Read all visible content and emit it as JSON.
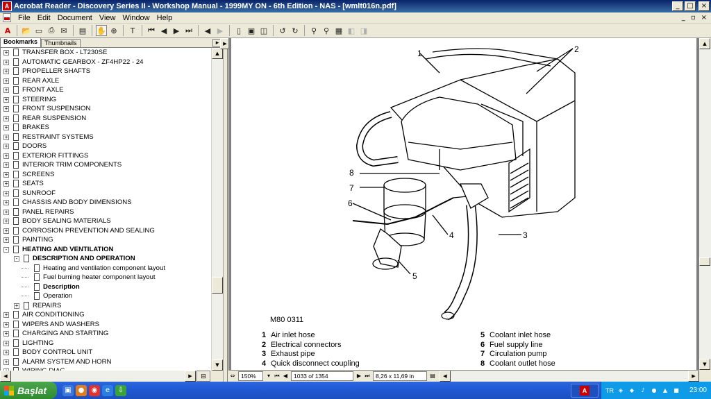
{
  "window": {
    "title": "Acrobat Reader - Discovery Series II - Workshop Manual - 1999MY ON - 6th Edition - NAS - [wmlt016n.pdf]",
    "buttons": [
      "_",
      "□",
      "×"
    ]
  },
  "menu": {
    "items": [
      "File",
      "Edit",
      "Document",
      "View",
      "Window",
      "Help"
    ],
    "doc_controls": [
      "_",
      "▫",
      "×"
    ]
  },
  "toolbar": {
    "icons": [
      "acrobat-icon",
      "open-icon",
      "save-icon",
      "print-icon",
      "email-icon",
      "show-hide-nav-icon",
      "hand-tool-icon",
      "zoom-tool-icon",
      "text-select-icon",
      "first-page-icon",
      "previous-page-icon",
      "next-page-icon",
      "last-page-icon",
      "go-back-icon",
      "go-forward-icon",
      "actual-size-icon",
      "fit-page-icon",
      "fit-width-icon",
      "rotate-left-icon",
      "rotate-right-icon",
      "find-icon",
      "search-icon",
      "search-results-icon",
      "previous-highlight-icon",
      "next-highlight-icon"
    ]
  },
  "nav": {
    "tabs": [
      "Bookmarks",
      "Thumbnails"
    ],
    "tab_menu": "▸",
    "bookmarks": [
      {
        "label": "TRANSFER BOX - LT230SE",
        "level": 0,
        "expand": "+",
        "bold": false
      },
      {
        "label": "AUTOMATIC GEARBOX - ZF4HP22 - 24",
        "level": 0,
        "expand": "+",
        "bold": false
      },
      {
        "label": "PROPELLER SHAFTS",
        "level": 0,
        "expand": "+",
        "bold": false
      },
      {
        "label": "REAR AXLE",
        "level": 0,
        "expand": "+",
        "bold": false
      },
      {
        "label": "FRONT AXLE",
        "level": 0,
        "expand": "+",
        "bold": false
      },
      {
        "label": "STEERING",
        "level": 0,
        "expand": "+",
        "bold": false
      },
      {
        "label": "FRONT SUSPENSION",
        "level": 0,
        "expand": "+",
        "bold": false
      },
      {
        "label": "REAR SUSPENSION",
        "level": 0,
        "expand": "+",
        "bold": false
      },
      {
        "label": "BRAKES",
        "level": 0,
        "expand": "+",
        "bold": false
      },
      {
        "label": "RESTRAINT SYSTEMS",
        "level": 0,
        "expand": "+",
        "bold": false
      },
      {
        "label": "DOORS",
        "level": 0,
        "expand": "+",
        "bold": false
      },
      {
        "label": "EXTERIOR FITTINGS",
        "level": 0,
        "expand": "+",
        "bold": false
      },
      {
        "label": "INTERIOR TRIM COMPONENTS",
        "level": 0,
        "expand": "+",
        "bold": false
      },
      {
        "label": "SCREENS",
        "level": 0,
        "expand": "+",
        "bold": false
      },
      {
        "label": "SEATS",
        "level": 0,
        "expand": "+",
        "bold": false
      },
      {
        "label": "SUNROOF",
        "level": 0,
        "expand": "+",
        "bold": false
      },
      {
        "label": "CHASSIS AND BODY DIMENSIONS",
        "level": 0,
        "expand": "+",
        "bold": false
      },
      {
        "label": "PANEL REPAIRS",
        "level": 0,
        "expand": "+",
        "bold": false
      },
      {
        "label": "BODY SEALING MATERIALS",
        "level": 0,
        "expand": "+",
        "bold": false
      },
      {
        "label": "CORROSION PREVENTION AND SEALING",
        "level": 0,
        "expand": "+",
        "bold": false
      },
      {
        "label": "PAINTING",
        "level": 0,
        "expand": "+",
        "bold": false
      },
      {
        "label": "HEATING AND VENTILATION",
        "level": 0,
        "expand": "-",
        "bold": true
      },
      {
        "label": "DESCRIPTION AND OPERATION",
        "level": 1,
        "expand": "-",
        "bold": true
      },
      {
        "label": "Heating and ventilation component layout",
        "level": 2,
        "expand": "",
        "bold": false
      },
      {
        "label": "Fuel burning heater component layout",
        "level": 2,
        "expand": "",
        "bold": false
      },
      {
        "label": "Description",
        "level": 2,
        "expand": "",
        "bold": true
      },
      {
        "label": "Operation",
        "level": 2,
        "expand": "",
        "bold": false
      },
      {
        "label": "REPAIRS",
        "level": 1,
        "expand": "+",
        "bold": false
      },
      {
        "label": "AIR CONDITIONING",
        "level": 0,
        "expand": "+",
        "bold": false
      },
      {
        "label": "WIPERS AND WASHERS",
        "level": 0,
        "expand": "+",
        "bold": false
      },
      {
        "label": "CHARGING AND STARTING",
        "level": 0,
        "expand": "+",
        "bold": false
      },
      {
        "label": "LIGHTING",
        "level": 0,
        "expand": "+",
        "bold": false
      },
      {
        "label": "BODY CONTROL UNIT",
        "level": 0,
        "expand": "+",
        "bold": false
      },
      {
        "label": "ALARM SYSTEM AND HORN",
        "level": 0,
        "expand": "+",
        "bold": false
      },
      {
        "label": "WIRING DIAG",
        "level": 0,
        "expand": "+",
        "bold": false
      }
    ]
  },
  "document": {
    "figure_id": "M80 0311",
    "callouts": [
      "1",
      "2",
      "8",
      "7",
      "6",
      "4",
      "3",
      "5"
    ],
    "legend_left": [
      {
        "num": "1",
        "text": "Air inlet hose"
      },
      {
        "num": "2",
        "text": "Electrical connectors"
      },
      {
        "num": "3",
        "text": "Exhaust pipe"
      },
      {
        "num": "4",
        "text": "Quick disconnect coupling"
      }
    ],
    "legend_right": [
      {
        "num": "5",
        "text": "Coolant inlet hose"
      },
      {
        "num": "6",
        "text": "Fuel supply line"
      },
      {
        "num": "7",
        "text": "Circulation pump"
      },
      {
        "num": "8",
        "text": "Coolant outlet hose"
      }
    ]
  },
  "status": {
    "zoom": "150%",
    "page": "1033 of 1354",
    "page_size": "8,26 x 11,69 in"
  },
  "taskbar": {
    "start_label": "Başlat",
    "language": "TR",
    "clock": "23:00"
  }
}
